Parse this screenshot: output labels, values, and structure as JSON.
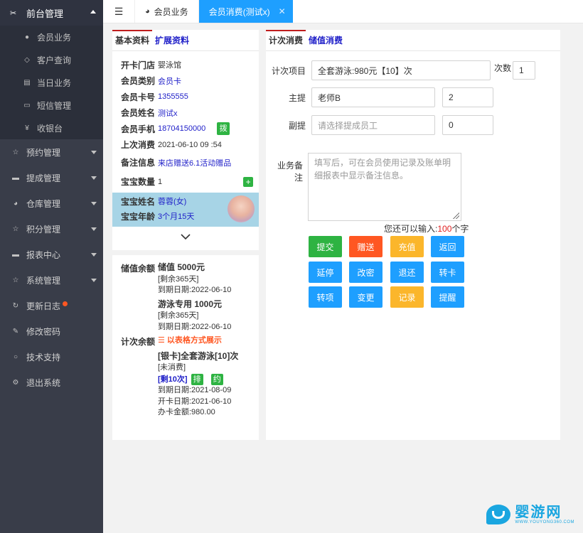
{
  "sidebar": {
    "active_menu": {
      "label": "前台管理",
      "icon": "tools-icon"
    },
    "sub_items": [
      {
        "label": "会员业务",
        "icon": "user-icon"
      },
      {
        "label": "客户查询",
        "icon": "diamond-icon"
      },
      {
        "label": "当日业务",
        "icon": "document-icon"
      },
      {
        "label": "短信管理",
        "icon": "message-icon"
      },
      {
        "label": "收银台",
        "icon": "yen-icon"
      }
    ],
    "menus": [
      {
        "label": "预约管理",
        "icon": "star-icon",
        "caret": true
      },
      {
        "label": "提成管理",
        "icon": "monitor-icon",
        "caret": true
      },
      {
        "label": "仓库管理",
        "icon": "dashboard-icon",
        "caret": true
      },
      {
        "label": "积分管理",
        "icon": "star-icon",
        "caret": true
      },
      {
        "label": "报表中心",
        "icon": "monitor-icon",
        "caret": true
      },
      {
        "label": "系统管理",
        "icon": "star-icon",
        "caret": true
      },
      {
        "label": "更新日志",
        "icon": "refresh-icon",
        "dot": true
      },
      {
        "label": "修改密码",
        "icon": "edit-icon"
      },
      {
        "label": "技术支持",
        "icon": "support-icon"
      },
      {
        "label": "退出系统",
        "icon": "gears-icon"
      }
    ]
  },
  "tabs": [
    {
      "label": "会员业务",
      "icon": "dashboard-icon"
    },
    {
      "label": "会员消费(测试x)",
      "active": true,
      "close": "✕"
    }
  ],
  "left_card": {
    "tabs": [
      "基本资料",
      "扩展资料"
    ],
    "fields": [
      {
        "label": "开卡门店",
        "value": "婴泳馆"
      },
      {
        "label": "会员类别",
        "value": "会员卡",
        "blue": true
      },
      {
        "label": "会员卡号",
        "value": "1355555",
        "blue": true
      },
      {
        "label": "会员姓名",
        "value": "测试x",
        "blue": true
      },
      {
        "label": "会员手机",
        "value": "18704150000",
        "blue": true,
        "button": "拨"
      },
      {
        "label": "上次消费",
        "value": "2021-06-10 09 :54"
      },
      {
        "label": "备注信息",
        "value": "来店赠送6.1活动赠品",
        "blue": true
      }
    ],
    "baby_count": {
      "label": "宝宝数量",
      "value": "1",
      "button": "+"
    },
    "baby": {
      "name_label": "宝宝姓名",
      "name_value": "蓉蓉(女)",
      "age_label": "宝宝年龄",
      "age_value": "3个月15天"
    }
  },
  "balance": {
    "stored_label": "储值余额",
    "stored": [
      {
        "title": "储值 5000元",
        "remain": "[剩余365天]",
        "expire": "到期日期:2022-06-10"
      },
      {
        "title": "游泳专用 1000元",
        "remain": "[剩余365天]",
        "expire": "到期日期:2022-06-10"
      }
    ],
    "count_label": "计次余额",
    "table_link": "☰ 以表格方式展示",
    "count_item": {
      "title": "[银卡]全套游泳[10]次",
      "status": "[未消费]",
      "remain": "[剩10次]",
      "btn1": "排",
      "btn2": "约",
      "expire": "到期日期:2021-08-09",
      "open_date": "开卡日期:2021-06-10",
      "amount": "办卡金额:980.00"
    }
  },
  "right_card": {
    "tabs": [
      "计次消费",
      "储值消费"
    ],
    "item_label": "计次项目",
    "item_value": "全套游泳:980元【10】次",
    "times_label": "次数",
    "times_value": "1",
    "main_label": "主提",
    "main_value": "老师B",
    "main_count": "2",
    "vice_label": "副提",
    "vice_placeholder": "请选择提成员工",
    "vice_count": "0",
    "note_label": "业务备注",
    "note_placeholder": "填写后，可在会员使用记录及账单明细报表中显示备注信息。",
    "counter_prefix": "您还可以输入:",
    "counter_num": "100",
    "counter_suffix": "个字",
    "buttons": [
      {
        "label": "提交",
        "color": "green"
      },
      {
        "label": "赠送",
        "color": "red"
      },
      {
        "label": "充值",
        "color": "yellow"
      },
      {
        "label": "返回",
        "color": "blue"
      },
      {
        "label": "延停",
        "color": "blue"
      },
      {
        "label": "改密",
        "color": "blue"
      },
      {
        "label": "退还",
        "color": "blue"
      },
      {
        "label": "转卡",
        "color": "blue"
      },
      {
        "label": "转项",
        "color": "blue"
      },
      {
        "label": "变更",
        "color": "blue"
      },
      {
        "label": "记录",
        "color": "yellow"
      },
      {
        "label": "提醒",
        "color": "blue"
      }
    ]
  },
  "watermark": {
    "text": "婴游网",
    "sub": "WWW.YOUYONG360.COM"
  }
}
